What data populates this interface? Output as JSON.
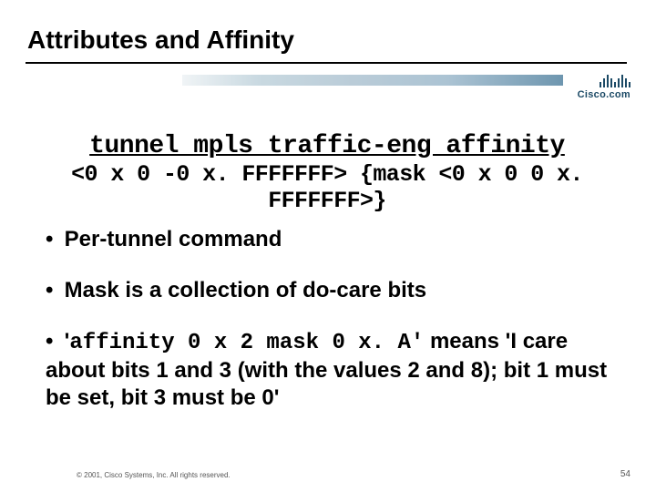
{
  "title": "Attributes and Affinity",
  "logo_text": "Cisco.com",
  "code": {
    "command": "tunnel mpls traffic-eng affinity",
    "args": "<0 x 0 -0 x. FFFFFFF> {mask <0 x 0 0 x. FFFFFFF>}"
  },
  "bullets": {
    "b1": "Per-tunnel command",
    "b2": "Mask is a collection of do-care bits",
    "b3_prefix": "'",
    "b3_code": "affinity 0 x 2 mask 0 x. A'",
    "b3_rest": "means 'I care about bits 1 and 3 (with the values 2 and 8); bit 1 must be set, bit 3 must be 0'"
  },
  "footer": "© 2001, Cisco Systems, Inc. All rights reserved.",
  "page": "54"
}
